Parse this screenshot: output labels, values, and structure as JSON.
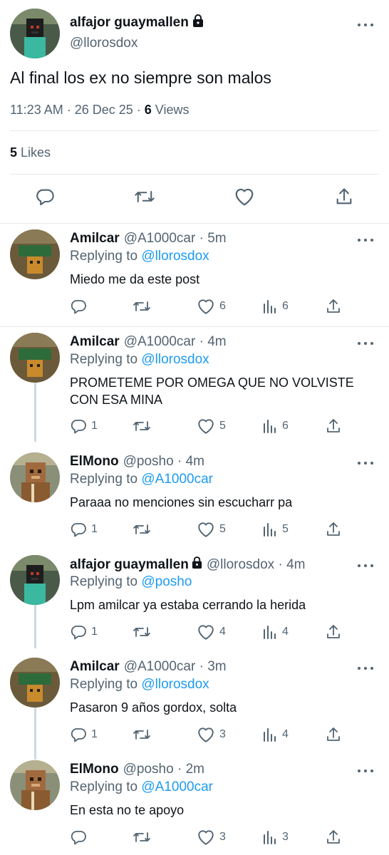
{
  "main_tweet": {
    "name": "alfajor guaymallen",
    "handle": "@llorosdox",
    "text": "Al final los ex no siempre son malos",
    "time": "11:23 AM · 26 Dec 25 · ",
    "views_count": "6",
    "views_label": " Views",
    "likes_count": "5",
    "likes_label": " Likes"
  },
  "icons": {
    "reply": "reply-icon",
    "retweet": "retweet-icon",
    "like": "heart-icon",
    "views": "views-icon",
    "share": "share-icon",
    "lock": "lock-icon",
    "more": "more-icon"
  },
  "colors": {
    "link": "#1d9bf0",
    "secondary": "#536471",
    "text": "#0f1419",
    "divider": "#e6e9ec",
    "thread_line": "#cfd9de"
  },
  "replies": [
    {
      "name": "Amilcar",
      "handle": "@A1000car",
      "time": "5m",
      "replying_prefix": "Replying to ",
      "replying_to": "@llorosdox",
      "text": "Miedo me da este post",
      "reply_count": "",
      "like_count": "6",
      "view_count": "6"
    },
    {
      "name": "Amilcar",
      "handle": "@A1000car",
      "time": "4m",
      "replying_prefix": "Replying to ",
      "replying_to": "@llorosdox",
      "text": "PROMETEME POR OMEGA QUE NO VOLVISTE CON ESA MINA",
      "reply_count": "1",
      "like_count": "5",
      "view_count": "6"
    },
    {
      "name": "ElMono",
      "handle": "@posho",
      "time": "4m",
      "replying_prefix": "Replying to ",
      "replying_to": "@A1000car",
      "text": "Paraaa no menciones sin escucharr pa",
      "reply_count": "1",
      "like_count": "5",
      "view_count": "5"
    },
    {
      "name": "alfajor guaymallen",
      "handle": "@llorosdox",
      "time": "4m",
      "replying_prefix": "Replying to ",
      "replying_to": "@posho",
      "text": "Lpm amilcar ya estaba cerrando la herida",
      "reply_count": "1",
      "like_count": "4",
      "view_count": "4"
    },
    {
      "name": "Amilcar",
      "handle": "@A1000car",
      "time": "3m",
      "replying_prefix": "Replying to ",
      "replying_to": "@llorosdox",
      "text": "Pasaron 9 años gordox, solta",
      "reply_count": "1",
      "like_count": "3",
      "view_count": "4"
    },
    {
      "name": "ElMono",
      "handle": "@posho",
      "time": "2m",
      "replying_prefix": "Replying to ",
      "replying_to": "@A1000car",
      "text": "En esta no te apoyo",
      "reply_count": "",
      "like_count": "3",
      "view_count": "3"
    }
  ]
}
